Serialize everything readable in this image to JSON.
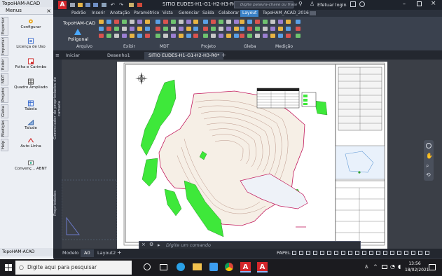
{
  "palette": {
    "title": "TopoHAM-ACAD",
    "menus_label": "Menus",
    "close_glyph": "×",
    "vertical_tabs": [
      "Exportar",
      "Importar",
      "Exibir",
      "MDT",
      "Projeto",
      "Gleba",
      "Medição",
      "Help"
    ],
    "tools": [
      {
        "label": "Configurar",
        "icon": "gear-icon"
      },
      {
        "label": "Licença de Uso",
        "icon": "license-icon"
      },
      {
        "label": "Folha e Carimbo",
        "icon": "sheet-stamp-icon"
      },
      {
        "label": "Quadro Ampliado",
        "icon": "enlarged-table-icon"
      },
      {
        "label": "Tabela",
        "icon": "table-icon"
      },
      {
        "label": "Talude",
        "icon": "slope-icon"
      },
      {
        "label": "Auto Linha",
        "icon": "auto-line-icon"
      },
      {
        "label": "Convenç... ABNT",
        "icon": "abnt-icon"
      }
    ],
    "footer": "TopoHAM-ACAD"
  },
  "titlebar": {
    "app_letter": "A",
    "document": "SITIO EUDES-H1-G1-H2-H3-R0.dwg",
    "search_placeholder": "Digite palavra-chave ou frase",
    "login": "Efetuar login"
  },
  "ribbon_tabs": [
    "Padrão",
    "Inserir",
    "Anotação",
    "Paramétrico",
    "Vista",
    "Gerenciar",
    "Saída",
    "Colaborar",
    "Layout",
    "TopoHAM_ACAD_2016"
  ],
  "ribbon_active": "Layout",
  "ribbon": {
    "left_title": "TopoHAM-CAD",
    "poligonal": "Poligonal",
    "panels": [
      "Arquivo",
      "Exibir",
      "MDT",
      "Projeto",
      "Gleba",
      "Medição"
    ]
  },
  "doc_tabs": [
    "Iniciar",
    "Desenho1",
    "SITIO EUDES-H1-G1-H2-H3-R0*"
  ],
  "doc_tab_active": "SITIO EUDES-H1-G1-H2-H3-R0*",
  "left_strip": [
    "Gerenciador de propriedades de camada",
    "Propriedades"
  ],
  "command_placeholder": "Digite um comando",
  "layout_tabs": [
    "Modelo",
    "A0",
    "Layout2"
  ],
  "layout_active": "A0",
  "status": {
    "paper": "PAPEL"
  },
  "taskbar": {
    "search_placeholder": "Digite aqui para pesquisar",
    "time": "13:56",
    "date": "18/02/2021"
  },
  "colors": {
    "accent": "#3b82c7",
    "autocad_red": "#d4262b",
    "green_area": "#3ee83a",
    "titlebar": "#1e232c"
  }
}
